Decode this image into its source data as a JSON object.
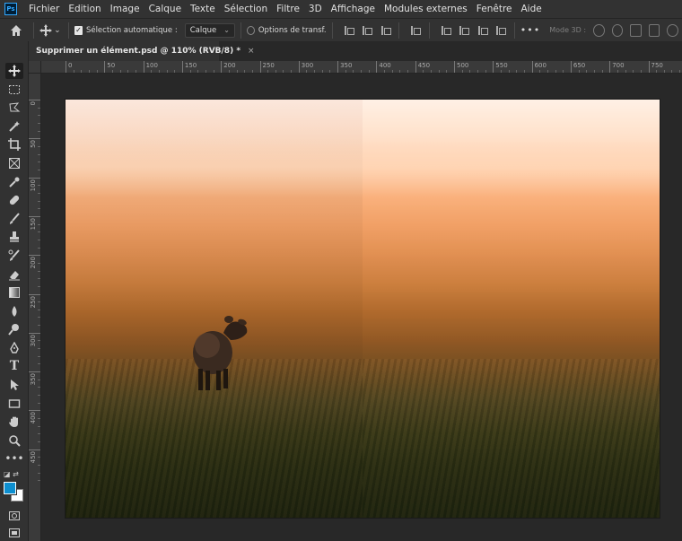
{
  "app": {
    "logo": "Ps"
  },
  "menu": {
    "items": [
      "Fichier",
      "Edition",
      "Image",
      "Calque",
      "Texte",
      "Sélection",
      "Filtre",
      "3D",
      "Affichage",
      "Modules externes",
      "Fenêtre",
      "Aide"
    ]
  },
  "options": {
    "auto_select_label": "Sélection automatique :",
    "auto_select_checked": true,
    "target_select": "Calque",
    "transform_label": "Options de transf.",
    "transform_checked": false,
    "more_label": "•••",
    "mode3d_label": "Mode 3D :"
  },
  "document": {
    "tab_title": "Supprimer un élément.psd @ 110% (RVB/8) *",
    "close_glyph": "×"
  },
  "rulers": {
    "horizontal": [
      "0",
      "50",
      "100",
      "150",
      "200",
      "250",
      "300",
      "350",
      "400",
      "450",
      "500",
      "550",
      "600",
      "650",
      "700",
      "750"
    ],
    "vertical": [
      "0",
      "50",
      "100",
      "150",
      "200",
      "250",
      "300",
      "350",
      "400",
      "450"
    ]
  },
  "tools": [
    "move-tool-icon",
    "marquee-tool-icon",
    "lasso-tool-icon",
    "magic-wand-tool-icon",
    "crop-tool-icon",
    "frame-tool-icon",
    "eyedropper-tool-icon",
    "healing-brush-tool-icon",
    "brush-tool-icon",
    "clone-stamp-tool-icon",
    "history-brush-tool-icon",
    "eraser-tool-icon",
    "gradient-tool-icon",
    "blur-tool-icon",
    "dodge-tool-icon",
    "pen-tool-icon",
    "type-tool-icon",
    "path-selection-tool-icon",
    "rectangle-tool-icon",
    "hand-tool-icon",
    "zoom-tool-icon",
    "more-tools-icon"
  ],
  "colors": {
    "foreground": "#0d8fd0",
    "background": "#ffffff"
  }
}
